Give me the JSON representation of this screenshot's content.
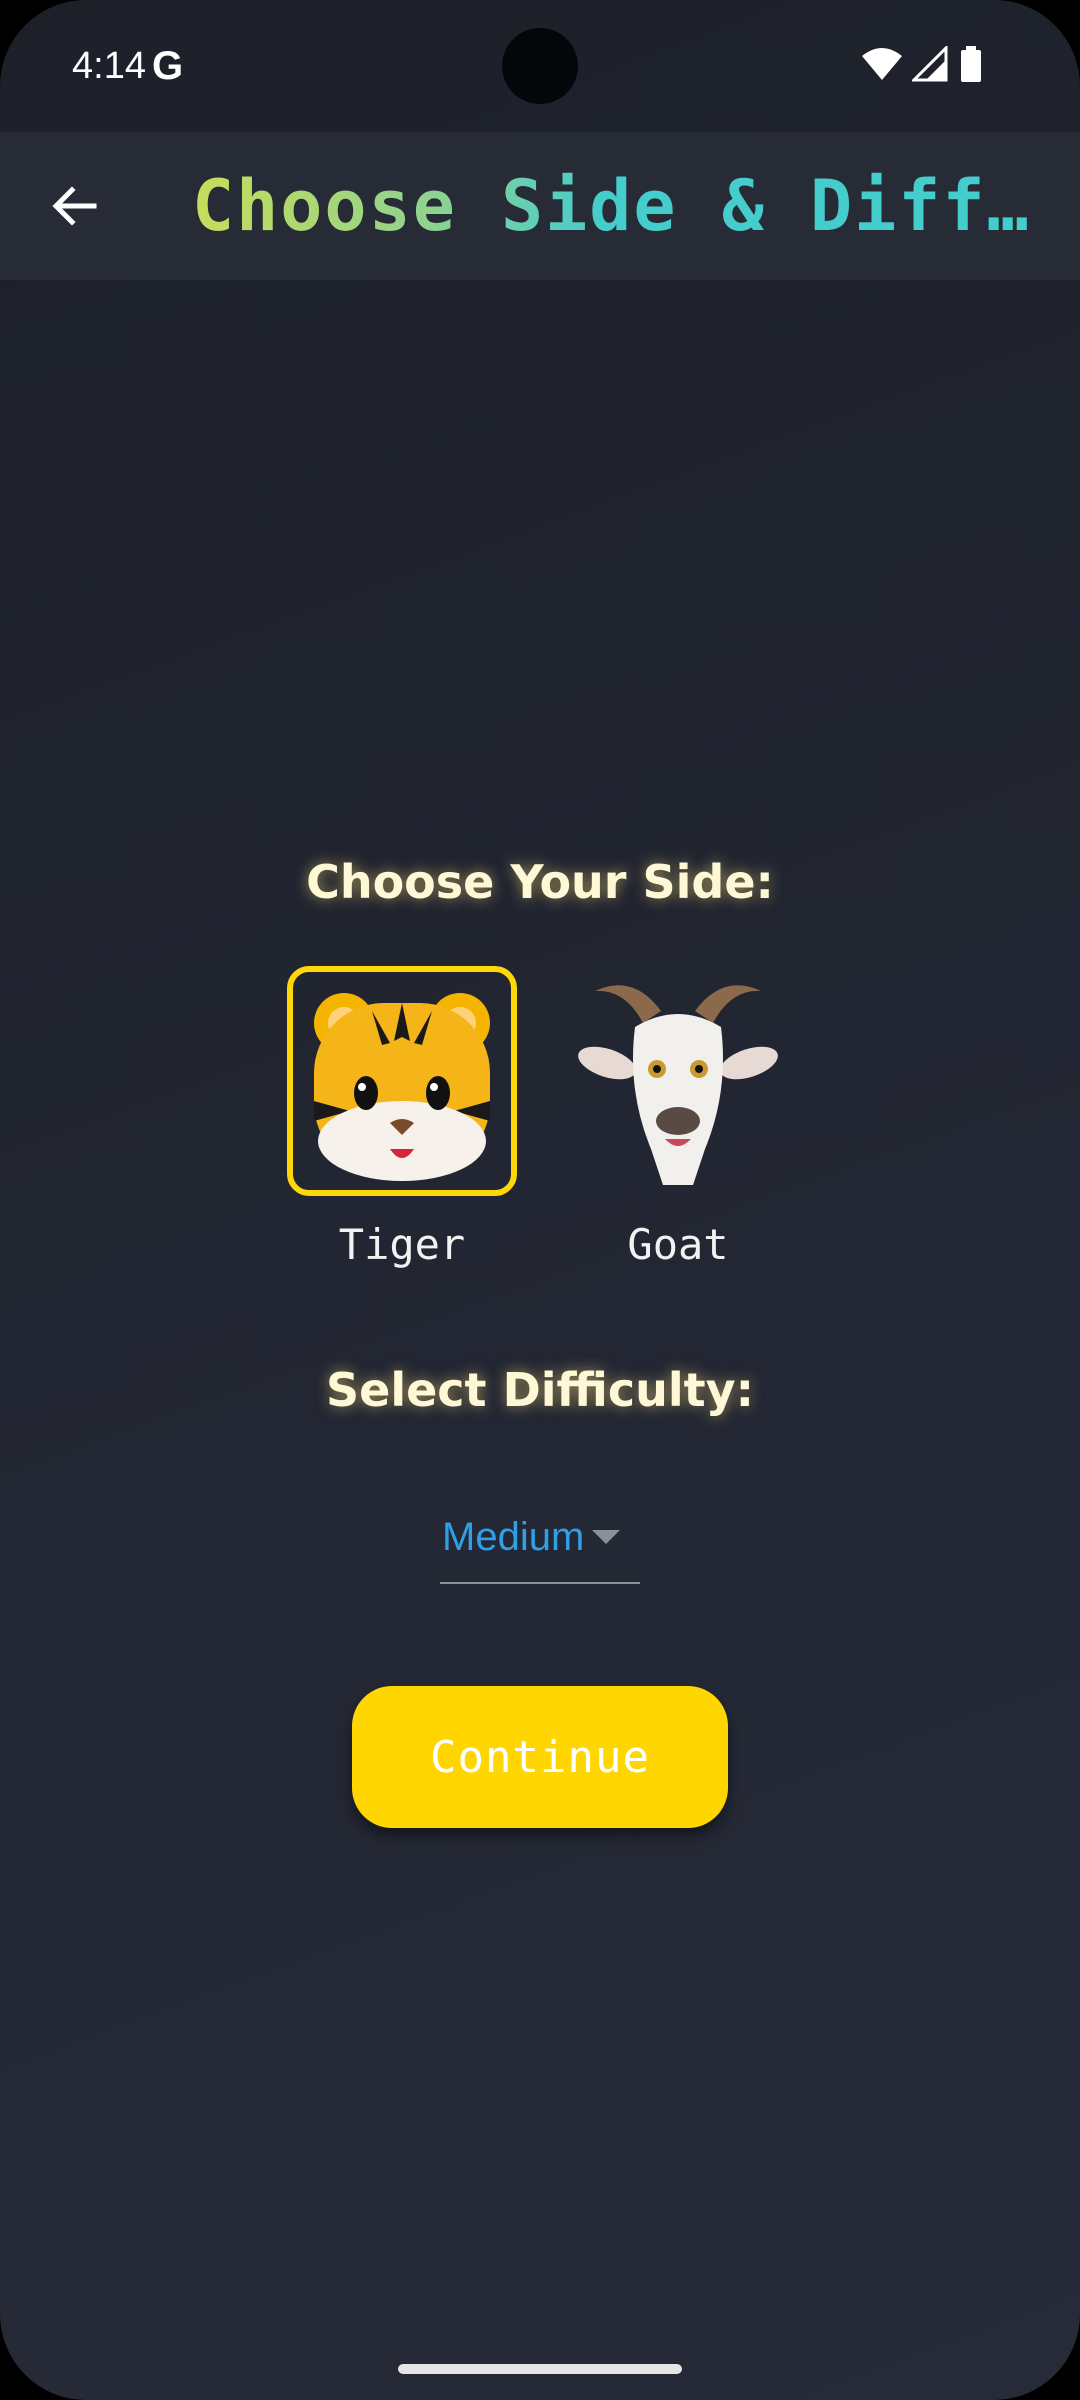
{
  "status_bar": {
    "time": "4:14",
    "g_logo": "G",
    "icons": [
      "wifi-icon",
      "cellular-signal-icon",
      "battery-icon"
    ]
  },
  "app_bar": {
    "back_icon": "arrow-left-icon",
    "title": "Choose Side & Difficulty"
  },
  "side_section": {
    "heading": "Choose Your Side:",
    "options": [
      {
        "label": "Tiger",
        "icon": "tiger-face-icon",
        "emoji": "🐯",
        "selected": true
      },
      {
        "label": "Goat",
        "icon": "goat-icon",
        "emoji": "🐐",
        "selected": false
      }
    ]
  },
  "difficulty_section": {
    "heading": "Select Difficulty:",
    "selected_value": "Medium"
  },
  "continue_button": {
    "label": "Continue"
  },
  "colors": {
    "accent_yellow": "#ffd600",
    "title_green": "#c8dd5a",
    "title_teal": "#45cccc",
    "dropdown_blue": "#2f9fe6",
    "background": "#232733"
  }
}
